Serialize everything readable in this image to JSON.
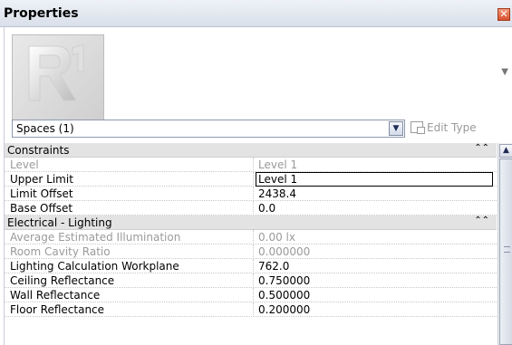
{
  "window": {
    "title": "Properties",
    "close_glyph": "✕"
  },
  "type_selector": {
    "selected": "Spaces (1)",
    "edit_type_label": "Edit Type"
  },
  "groups": [
    {
      "label": "Constraints",
      "rows": [
        {
          "name": "Level",
          "value": "Level 1"
        },
        {
          "name": "Upper Limit",
          "value": "Level 1"
        },
        {
          "name": "Limit Offset",
          "value": "2438.4"
        },
        {
          "name": "Base Offset",
          "value": "0.0"
        }
      ]
    },
    {
      "label": "Electrical - Lighting",
      "rows": [
        {
          "name": "Average Estimated Illumination",
          "value": "0.00 lx"
        },
        {
          "name": "Room Cavity Ratio",
          "value": "0.000000"
        },
        {
          "name": "Lighting Calculation Workplane",
          "value": "762.0"
        },
        {
          "name": "Ceiling Reflectance",
          "value": "0.750000"
        },
        {
          "name": "Wall Reflectance",
          "value": "0.500000"
        },
        {
          "name": "Floor Reflectance",
          "value": "0.200000"
        }
      ]
    }
  ],
  "icons": {
    "preview": "revit-logo-icon",
    "collapse": "double-chevron-up-icon",
    "dropdown": "chevron-down-icon",
    "edit_type": "edit-type-icon"
  }
}
